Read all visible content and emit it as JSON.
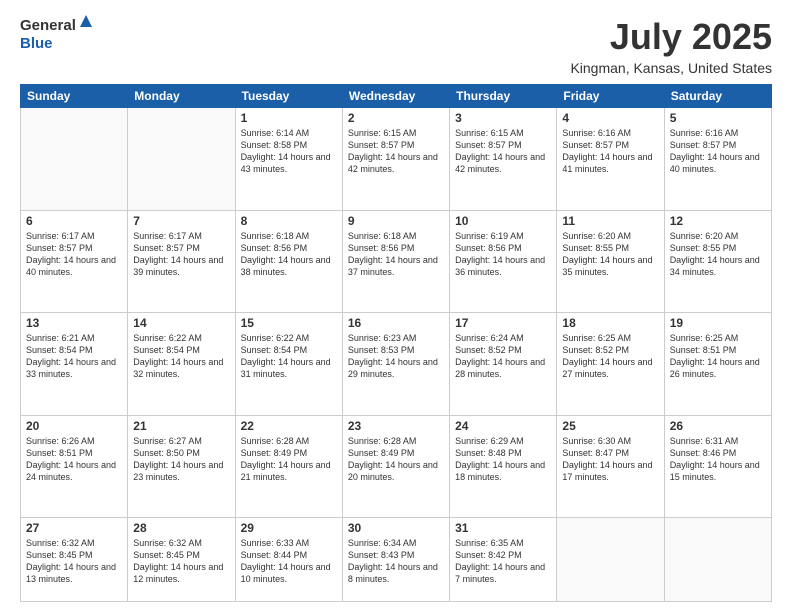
{
  "header": {
    "logo_general": "General",
    "logo_blue": "Blue",
    "month_title": "July 2025",
    "location": "Kingman, Kansas, United States"
  },
  "weekdays": [
    "Sunday",
    "Monday",
    "Tuesday",
    "Wednesday",
    "Thursday",
    "Friday",
    "Saturday"
  ],
  "rows": [
    [
      {
        "day": "",
        "empty": true
      },
      {
        "day": "",
        "empty": true
      },
      {
        "day": "1",
        "sunrise": "Sunrise: 6:14 AM",
        "sunset": "Sunset: 8:58 PM",
        "daylight": "Daylight: 14 hours and 43 minutes."
      },
      {
        "day": "2",
        "sunrise": "Sunrise: 6:15 AM",
        "sunset": "Sunset: 8:57 PM",
        "daylight": "Daylight: 14 hours and 42 minutes."
      },
      {
        "day": "3",
        "sunrise": "Sunrise: 6:15 AM",
        "sunset": "Sunset: 8:57 PM",
        "daylight": "Daylight: 14 hours and 42 minutes."
      },
      {
        "day": "4",
        "sunrise": "Sunrise: 6:16 AM",
        "sunset": "Sunset: 8:57 PM",
        "daylight": "Daylight: 14 hours and 41 minutes."
      },
      {
        "day": "5",
        "sunrise": "Sunrise: 6:16 AM",
        "sunset": "Sunset: 8:57 PM",
        "daylight": "Daylight: 14 hours and 40 minutes."
      }
    ],
    [
      {
        "day": "6",
        "sunrise": "Sunrise: 6:17 AM",
        "sunset": "Sunset: 8:57 PM",
        "daylight": "Daylight: 14 hours and 40 minutes."
      },
      {
        "day": "7",
        "sunrise": "Sunrise: 6:17 AM",
        "sunset": "Sunset: 8:57 PM",
        "daylight": "Daylight: 14 hours and 39 minutes."
      },
      {
        "day": "8",
        "sunrise": "Sunrise: 6:18 AM",
        "sunset": "Sunset: 8:56 PM",
        "daylight": "Daylight: 14 hours and 38 minutes."
      },
      {
        "day": "9",
        "sunrise": "Sunrise: 6:18 AM",
        "sunset": "Sunset: 8:56 PM",
        "daylight": "Daylight: 14 hours and 37 minutes."
      },
      {
        "day": "10",
        "sunrise": "Sunrise: 6:19 AM",
        "sunset": "Sunset: 8:56 PM",
        "daylight": "Daylight: 14 hours and 36 minutes."
      },
      {
        "day": "11",
        "sunrise": "Sunrise: 6:20 AM",
        "sunset": "Sunset: 8:55 PM",
        "daylight": "Daylight: 14 hours and 35 minutes."
      },
      {
        "day": "12",
        "sunrise": "Sunrise: 6:20 AM",
        "sunset": "Sunset: 8:55 PM",
        "daylight": "Daylight: 14 hours and 34 minutes."
      }
    ],
    [
      {
        "day": "13",
        "sunrise": "Sunrise: 6:21 AM",
        "sunset": "Sunset: 8:54 PM",
        "daylight": "Daylight: 14 hours and 33 minutes."
      },
      {
        "day": "14",
        "sunrise": "Sunrise: 6:22 AM",
        "sunset": "Sunset: 8:54 PM",
        "daylight": "Daylight: 14 hours and 32 minutes."
      },
      {
        "day": "15",
        "sunrise": "Sunrise: 6:22 AM",
        "sunset": "Sunset: 8:54 PM",
        "daylight": "Daylight: 14 hours and 31 minutes."
      },
      {
        "day": "16",
        "sunrise": "Sunrise: 6:23 AM",
        "sunset": "Sunset: 8:53 PM",
        "daylight": "Daylight: 14 hours and 29 minutes."
      },
      {
        "day": "17",
        "sunrise": "Sunrise: 6:24 AM",
        "sunset": "Sunset: 8:52 PM",
        "daylight": "Daylight: 14 hours and 28 minutes."
      },
      {
        "day": "18",
        "sunrise": "Sunrise: 6:25 AM",
        "sunset": "Sunset: 8:52 PM",
        "daylight": "Daylight: 14 hours and 27 minutes."
      },
      {
        "day": "19",
        "sunrise": "Sunrise: 6:25 AM",
        "sunset": "Sunset: 8:51 PM",
        "daylight": "Daylight: 14 hours and 26 minutes."
      }
    ],
    [
      {
        "day": "20",
        "sunrise": "Sunrise: 6:26 AM",
        "sunset": "Sunset: 8:51 PM",
        "daylight": "Daylight: 14 hours and 24 minutes."
      },
      {
        "day": "21",
        "sunrise": "Sunrise: 6:27 AM",
        "sunset": "Sunset: 8:50 PM",
        "daylight": "Daylight: 14 hours and 23 minutes."
      },
      {
        "day": "22",
        "sunrise": "Sunrise: 6:28 AM",
        "sunset": "Sunset: 8:49 PM",
        "daylight": "Daylight: 14 hours and 21 minutes."
      },
      {
        "day": "23",
        "sunrise": "Sunrise: 6:28 AM",
        "sunset": "Sunset: 8:49 PM",
        "daylight": "Daylight: 14 hours and 20 minutes."
      },
      {
        "day": "24",
        "sunrise": "Sunrise: 6:29 AM",
        "sunset": "Sunset: 8:48 PM",
        "daylight": "Daylight: 14 hours and 18 minutes."
      },
      {
        "day": "25",
        "sunrise": "Sunrise: 6:30 AM",
        "sunset": "Sunset: 8:47 PM",
        "daylight": "Daylight: 14 hours and 17 minutes."
      },
      {
        "day": "26",
        "sunrise": "Sunrise: 6:31 AM",
        "sunset": "Sunset: 8:46 PM",
        "daylight": "Daylight: 14 hours and 15 minutes."
      }
    ],
    [
      {
        "day": "27",
        "sunrise": "Sunrise: 6:32 AM",
        "sunset": "Sunset: 8:45 PM",
        "daylight": "Daylight: 14 hours and 13 minutes."
      },
      {
        "day": "28",
        "sunrise": "Sunrise: 6:32 AM",
        "sunset": "Sunset: 8:45 PM",
        "daylight": "Daylight: 14 hours and 12 minutes."
      },
      {
        "day": "29",
        "sunrise": "Sunrise: 6:33 AM",
        "sunset": "Sunset: 8:44 PM",
        "daylight": "Daylight: 14 hours and 10 minutes."
      },
      {
        "day": "30",
        "sunrise": "Sunrise: 6:34 AM",
        "sunset": "Sunset: 8:43 PM",
        "daylight": "Daylight: 14 hours and 8 minutes."
      },
      {
        "day": "31",
        "sunrise": "Sunrise: 6:35 AM",
        "sunset": "Sunset: 8:42 PM",
        "daylight": "Daylight: 14 hours and 7 minutes."
      },
      {
        "day": "",
        "empty": true
      },
      {
        "day": "",
        "empty": true
      }
    ]
  ]
}
